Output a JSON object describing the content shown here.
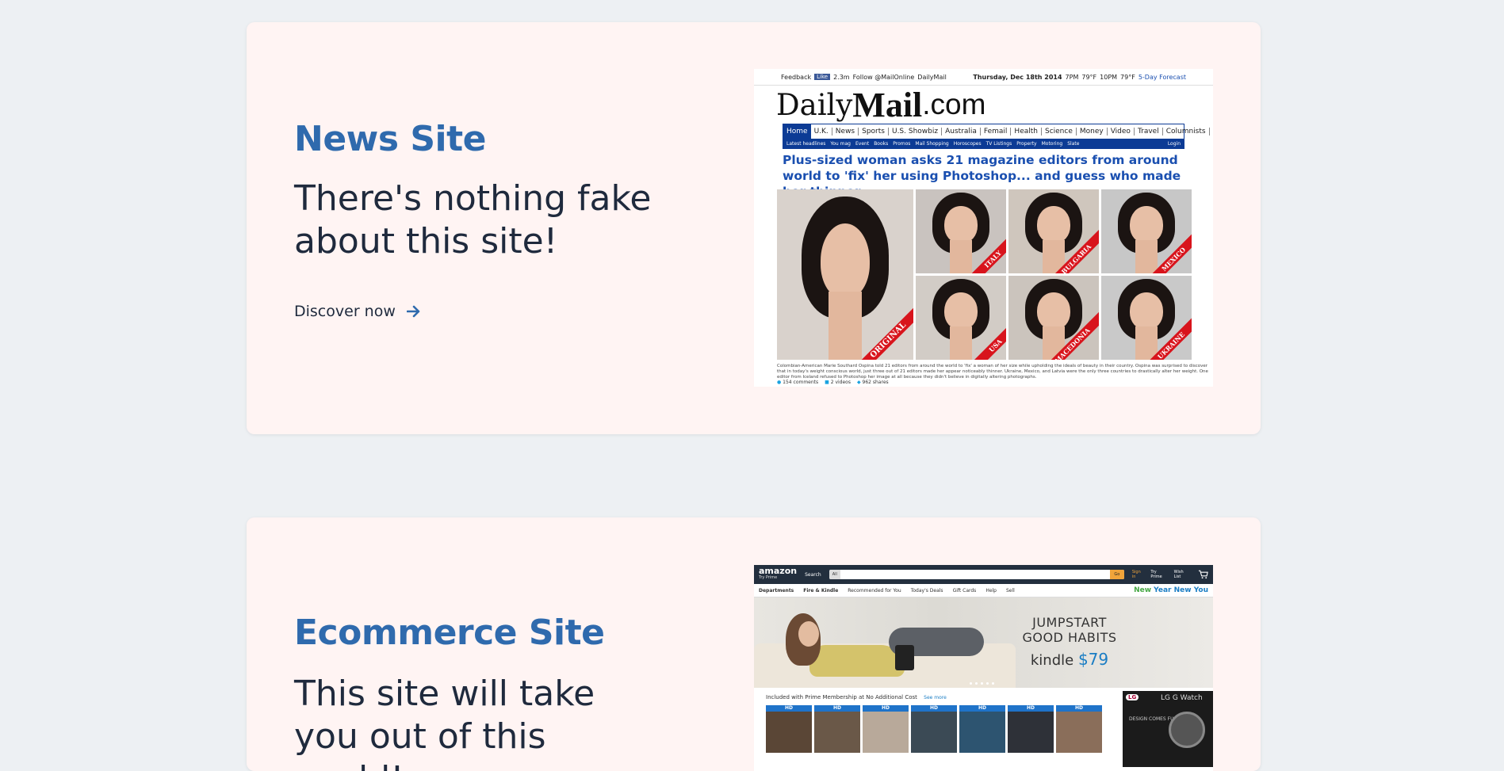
{
  "cards": [
    {
      "title": "News Site",
      "subtitle": "There's nothing fake about this site!",
      "cta": "Discover now",
      "thumbnail": {
        "topbar": {
          "feedback": "Feedback",
          "like": "Like",
          "like_count": "2.3m",
          "follow": "Follow @MailOnline",
          "pinterest": "DailyMail",
          "date": "Thursday, Dec 18th 2014",
          "forecast_7pm": "7PM",
          "temp_7pm": "79°F",
          "forecast_10pm": "10PM",
          "temp_10pm": "79°F",
          "forecast_link": "5-Day Forecast"
        },
        "logo": {
          "daily": "Daily",
          "mail": "Mail",
          "com": ".com"
        },
        "nav": [
          "Home",
          "U.K.",
          "News",
          "Sports",
          "U.S. Showbiz",
          "Australia",
          "Femail",
          "Health",
          "Science",
          "Money",
          "Video",
          "Travel",
          "Columnists"
        ],
        "subnav": [
          "Latest headlines",
          "You mag",
          "Event",
          "Books",
          "Promos",
          "Mail Shopping",
          "Horoscopes",
          "TV Listings",
          "Property",
          "Motoring",
          "Slate"
        ],
        "login": "Login",
        "headline": "Plus-sized woman asks 21 magazine editors from around world to 'fix' her using Photoshop... and guess who made her thinner",
        "photos": [
          "ORIGINAL",
          "ITALY",
          "BULGARIA",
          "MEXICO",
          "USA",
          "MACEDONIA",
          "UKRAINE"
        ],
        "caption": "Colombian-American Marie Southard Ospina told 21 editors from around the world to 'fix' a woman of her size while upholding the ideals of beauty in their country. Ospina was surprised to discover that in today's weight conscious world, just three out of 21 editors made her appear noticeably thinner. Ukraine, Mexico, and Latvia were the only three countries to drastically alter her weight. One editor from Iceland refused to Photoshop her image at all because they didn't believe in digitally altering photographs.",
        "meta": {
          "comments": "154 comments",
          "videos": "2 videos",
          "shares": "962 shares"
        }
      }
    },
    {
      "title": "Ecommerce Site",
      "subtitle": "This site will take you out of this world!",
      "thumbnail": {
        "logo": "amazon",
        "logo_sub": "Try Prime",
        "search_label": "Search",
        "search_all": "All",
        "go": "Go",
        "links": [
          "Sign in",
          "Try Prime",
          "Wish List"
        ],
        "subnav": [
          "Departments",
          "Fire & Kindle",
          "Recommended for You",
          "Today's Deals",
          "Gift Cards",
          "Help",
          "Sell"
        ],
        "promo": {
          "new": "New",
          "year": "Year",
          "new_you": "New You"
        },
        "banner": {
          "line1": "JUMPSTART",
          "line2": "GOOD HABITS",
          "brand": "kindle",
          "price": "$79"
        },
        "prime_text": "Included with Prime Membership at No Additional Cost",
        "see_more": "See more",
        "movies": [
          "HD",
          "HD",
          "HD",
          "HD",
          "HD",
          "HD",
          "HD"
        ],
        "ad": {
          "brand": "LG",
          "model": "LG G Watch",
          "text": "DESIGN COMES FULL CIRCLE"
        }
      }
    }
  ],
  "colors": {
    "page_bg": "#edf0f3",
    "card_bg": "#fff4f3",
    "title": "#2f6aad",
    "text": "#1f2a3d"
  }
}
